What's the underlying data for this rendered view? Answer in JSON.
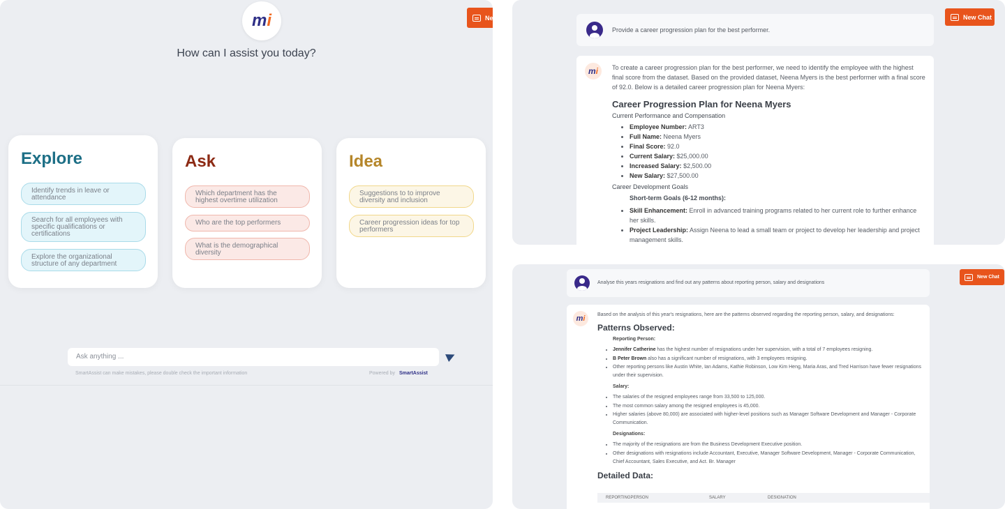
{
  "brand": {
    "logo_text": "m",
    "logo_dot": "i",
    "accent": "#e8541c",
    "navy": "#2e2f86"
  },
  "left": {
    "new_chat_label": "Ne",
    "headline": "How can I assist you today?",
    "cards": [
      {
        "title": "Explore",
        "title_color": "#1d6f86",
        "items": [
          "Identify trends in leave or attendance",
          "Search for all employees with specific qualifications or certifications",
          "Explore the organizational structure of any department"
        ]
      },
      {
        "title": "Ask",
        "title_color": "#8c2a14",
        "items": [
          "Which department has the highest overtime utilization",
          "Who are the top performers",
          "What is the demographical diversity"
        ]
      },
      {
        "title": "Idea",
        "title_color": "#b5862a",
        "items": [
          "Suggestions to to improve diversity and inclusion",
          "Career progression ideas for top performers"
        ]
      }
    ],
    "input_placeholder": "Ask anything ...",
    "disclaimer": "SmartAssist can make mistakes, please double check the important information",
    "powered_by": "Powered by",
    "powered_brand": "SmartAssist"
  },
  "top_right": {
    "new_chat_label": "New Chat",
    "user_msg": "Provide a career progression plan for the best performer.",
    "intro": "To create a career progression plan for the best performer, we need to identify the employee with the highest final score from the dataset. Based on the provided dataset, Neena Myers is the best performer with a final score of 92.0. Below is a detailed career progression plan for Neena Myers:",
    "plan_title": "Career Progression Plan for Neena Myers",
    "section1": "Current Performance and Compensation",
    "facts": [
      {
        "k": "Employee Number:",
        "v": "ART3"
      },
      {
        "k": "Full Name:",
        "v": "Neena Myers"
      },
      {
        "k": "Final Score:",
        "v": "92.0"
      },
      {
        "k": "Current Salary:",
        "v": "$25,000.00"
      },
      {
        "k": "Increased Salary:",
        "v": "$2,500.00"
      },
      {
        "k": "New Salary:",
        "v": "$27,500.00"
      }
    ],
    "section2": "Career Development Goals",
    "short_term": "Short-term Goals (6-12 months):",
    "goals": [
      {
        "k": "Skill Enhancement:",
        "v": "Enroll in advanced training programs related to her current role to further enhance her skills."
      },
      {
        "k": "Project Leadership:",
        "v": "Assign Neena to lead a small team or project to develop her leadership and project management skills."
      }
    ]
  },
  "bottom_right": {
    "new_chat_label": "New Chat",
    "user_msg": "Analyse this years resignations and find out any patterns about reporting person, salary and designations",
    "intro": "Based on the analysis of this year's resignations, here are the patterns observed regarding the reporting person, salary, and designations:",
    "patterns_title": "Patterns Observed:",
    "reporting_label": "Reporting Person:",
    "reporting": [
      {
        "b": "Jennifer Catherine",
        "t": " has the highest number of resignations under her supervision, with a total of 7 employees resigning."
      },
      {
        "b": "B Peter Brown",
        "t": " also has a significant number of resignations, with 3 employees resigning."
      },
      {
        "b": "",
        "t": "Other reporting persons like Austin White, Ian Adams, Kathie Robinson, Low Kim Heng, Maria Aras, and Tred Harrison have fewer resignations under their supervision."
      }
    ],
    "salary_label": "Salary:",
    "salary": [
      "The salaries of the resigned employees range from 33,500 to 125,000.",
      "The most common salary among the resigned employees is 45,000.",
      "Higher salaries (above 80,000) are associated with higher-level positions such as Manager Software Development and Manager - Corporate Communication."
    ],
    "designations_label": "Designations:",
    "designations": [
      "The majority of the resignations are from the Business Development Executive position.",
      "Other designations with resignations include Accountant, Executive, Manager Software Development, Manager - Corporate Communication, Chief Accountant, Sales Executive, and Act. Br. Manager"
    ],
    "detailed_title": "Detailed Data:",
    "table_headers": [
      "REPORTINGPERSON",
      "SALARY",
      "DESIGNATION"
    ]
  }
}
